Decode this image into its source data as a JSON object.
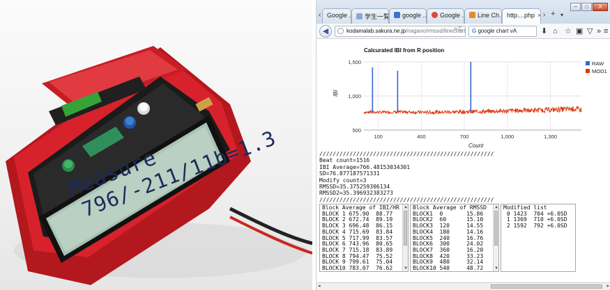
{
  "photo": {
    "lcd_line1": "Measure",
    "lcd_line2": "796/-211/11b=1.3"
  },
  "browser": {
    "tabs": [
      {
        "label": "Google ...",
        "fav": "#4a7fd6"
      },
      {
        "label": "学生一覧",
        "fav": "#8aa8d6"
      },
      {
        "label": "google ...",
        "fav": "#3b73d1"
      },
      {
        "label": "Google ...",
        "fav": "#d94a3a"
      },
      {
        "label": "Line Ch...",
        "fav": "#e08a2d"
      },
      {
        "label": "http....php",
        "fav": "#ffffff"
      }
    ],
    "close_tab_glyph": "×",
    "new_tab_glyph": "+",
    "url_host": "kodamalab.sakura.ne.jp",
    "url_path": "/nagano/rmssd/linechart",
    "search_text": "google chart vA",
    "win_close_glyph": "X"
  },
  "chart_data": {
    "type": "line",
    "title": "Calcurated IBI from R position",
    "xlabel": "Count",
    "ylabel": "IBI",
    "x_ticks": [
      "100",
      "400",
      "700",
      "1,000",
      "1,300"
    ],
    "x_tick_values": [
      100,
      400,
      700,
      1000,
      1300
    ],
    "y_ticks": [
      "500",
      "1,000",
      "1,500"
    ],
    "y_tick_values": [
      500,
      1000,
      1500
    ],
    "xlim": [
      0,
      1516
    ],
    "ylim": [
      500,
      1500
    ],
    "grid": true,
    "legend_position": "right",
    "series": [
      {
        "name": "RAW",
        "color": "#3366cc",
        "spikes": [
          {
            "x": 60,
            "y": 1420
          },
          {
            "x": 235,
            "y": 1370
          },
          {
            "x": 745,
            "y": 1500
          }
        ]
      },
      {
        "name": "MOD1",
        "color": "#dc3912",
        "trend": [
          [
            0,
            760
          ],
          [
            150,
            762
          ],
          [
            300,
            765
          ],
          [
            450,
            760
          ],
          [
            600,
            765
          ],
          [
            750,
            770
          ],
          [
            900,
            775
          ],
          [
            1050,
            785
          ],
          [
            1200,
            790
          ],
          [
            1350,
            800
          ],
          [
            1450,
            810
          ],
          [
            1516,
            800
          ]
        ]
      }
    ]
  },
  "console": {
    "sep1": "////////////////////////////////////////////////////",
    "beat_count": "Beat count=1516",
    "ibi_average": "IBI Average=766.48153034301",
    "sd": "SD=76.877187571331",
    "modify_count": "Modify count=3",
    "rmssd": "RMSSD=35.375259306134",
    "rmssd2": "RMSSD2=35.396932383273",
    "sep2": "////////////////////////////////////////////////////"
  },
  "panel1": {
    "header": "Block Average of IBI/HR",
    "rows": [
      "BLOCK 1 675.90  88.77",
      "BLOCK 2 672.74  89.19",
      "BLOCK 3 696.48  86.15",
      "BLOCK 4 715.69  83.84",
      "BLOCK 5 717.99  83.57",
      "BLOCK 6 743.96  80.65",
      "BLOCK 7 715.18  83.89",
      "BLOCK 8 794.47  75.52",
      "BLOCK 9 799.61  75.04",
      "BLOCK10 783.07  76.62"
    ]
  },
  "panel2": {
    "header": "Block Average of RMSSD",
    "rows": [
      "BLOCK1  0       15.86",
      "BLOCK2  60      15.10",
      "BLOCK3  120     14.55",
      "BLOCK4  180     14.16",
      "BLOCK5  240     16.76",
      "BLOCK6  300     24.02",
      "BLOCK7  360     16.20",
      "BLOCK8  420     33.23",
      "BLOCK9  480     32.14",
      "BLOCK10 540     48.72"
    ]
  },
  "panel3": {
    "header": "Modified list",
    "rows": [
      " 0 1423  704 +6.0SD",
      " 1 1369  710 +6.0SD",
      " 2 1592  792 +6.0SD"
    ]
  }
}
